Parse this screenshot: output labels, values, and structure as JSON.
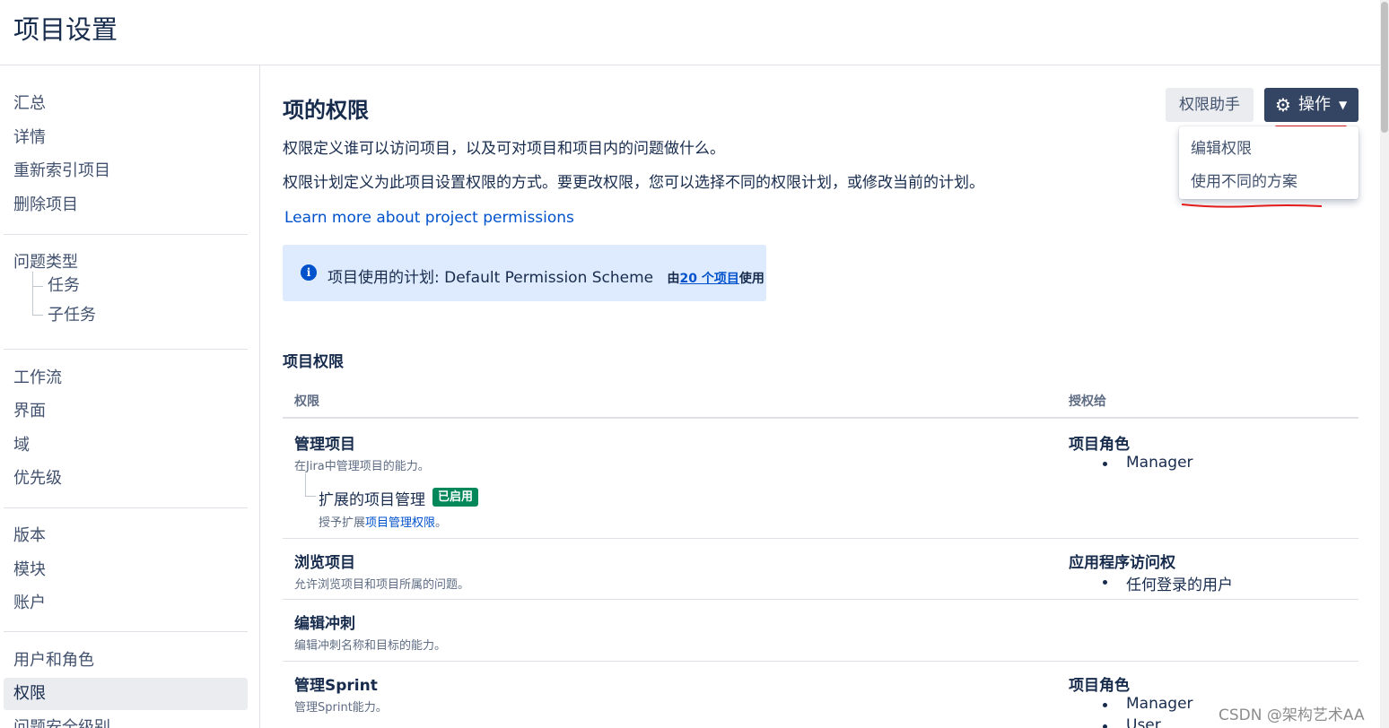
{
  "page": {
    "title": "项目设置"
  },
  "sidebar": {
    "group1": [
      "汇总",
      "详情",
      "重新索引项目",
      "删除项目"
    ],
    "issue_types": {
      "label": "问题类型",
      "children": [
        "任务",
        "子任务"
      ]
    },
    "group3": [
      "工作流",
      "界面",
      "域",
      "优先级"
    ],
    "group4": [
      "版本",
      "模块",
      "账户"
    ],
    "group5": [
      "用户和角色",
      "权限",
      "问题安全级别"
    ],
    "active": "权限"
  },
  "main": {
    "title": "项的权限",
    "desc1": "权限定义谁可以访问项目，以及可对项目和项目内的问题做什么。",
    "desc2": "权限计划定义为此项目设置权限的方式。要更改权限，您可以选择不同的权限计划，或修改当前的计划。",
    "learn_more": "Learn more about project permissions",
    "info": {
      "prefix": "项目使用的计划: Default Permission Scheme",
      "by": "由",
      "link": "20 个项目",
      "suffix": "使用"
    },
    "buttons": {
      "helper": "权限助手",
      "actions": "操作"
    },
    "dropdown": [
      "编辑权限",
      "使用不同的方案"
    ],
    "table": {
      "title": "项目权限",
      "col_permission": "权限",
      "col_granted": "授权给",
      "rows": [
        {
          "name": "管理项目",
          "desc": "在Jira中管理项目的能力。",
          "grant_title": "项目角色",
          "grants": [
            "Manager"
          ],
          "extension": {
            "name": "扩展的项目管理",
            "badge": "已启用",
            "desc_prefix": "授予扩展",
            "desc_link": "项目管理权限",
            "desc_suffix": "。"
          }
        },
        {
          "name": "浏览项目",
          "desc": "允许浏览项目和项目所属的问题。",
          "grant_title": "应用程序访问权",
          "grants": [
            "任何登录的用户"
          ]
        },
        {
          "name": "编辑冲刺",
          "desc": "编辑冲刺名称和目标的能力。",
          "grant_title": "",
          "grants": []
        },
        {
          "name": "管理Sprint",
          "desc": "管理Sprint能力。",
          "grant_title": "项目角色",
          "grants": [
            "Manager",
            "User"
          ]
        }
      ]
    }
  },
  "watermark": "CSDN @架构艺术AA",
  "colors": {
    "accent": "#0052cc",
    "dark_button": "#344563",
    "enabled_badge": "#00875a",
    "annotation": "#e31b1b"
  }
}
